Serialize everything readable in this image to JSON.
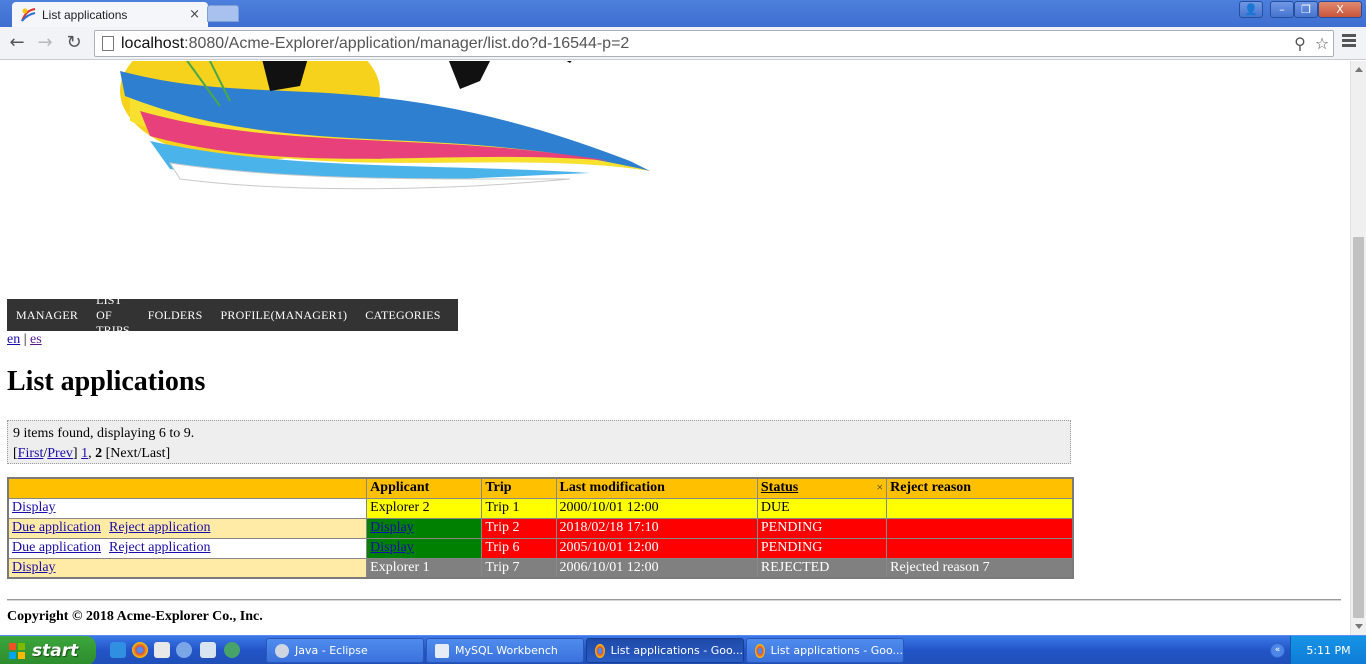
{
  "browser": {
    "tab_title": "List applications",
    "tab_close": "×",
    "url_host": "localhost",
    "url_rest": ":8080/Acme-Explorer/application/manager/list.do?d-16544-p=2",
    "window_buttons": {
      "user": "👤",
      "minimize": "–",
      "restore": "❐",
      "close": "X"
    }
  },
  "nav": {
    "back": "←",
    "forward": "→",
    "reload": "↻",
    "zoom_icon": "⚲",
    "star_icon": "☆"
  },
  "menu": {
    "items": [
      "MANAGER",
      "LIST OF TRIPS",
      "FOLDERS",
      "PROFILE(MANAGER1)",
      "CATEGORIES"
    ]
  },
  "languages": {
    "en": "en",
    "separator": " | ",
    "es": "es"
  },
  "page": {
    "title": "List applications",
    "found_text": "9 items found, displaying 6 to 9.",
    "pager": {
      "open": "[",
      "first": "First",
      "slash": "/",
      "prev": "Prev",
      "close": "] ",
      "page1": "1",
      "comma": ", ",
      "page2": "2",
      "tail": " [Next/Last]"
    }
  },
  "table": {
    "headers": {
      "actions": "",
      "applicant": "Applicant",
      "trip": "Trip",
      "last_modification": "Last modification",
      "status": "Status",
      "status_sort": "×",
      "reject_reason": "Reject reason"
    },
    "rows": [
      {
        "action1": "Display",
        "action2": "",
        "applicant": "Explorer 2",
        "trip": "Trip 1",
        "last_modification": "2000/10/01 12:00",
        "status": "DUE",
        "reject_reason": ""
      },
      {
        "action1": "Due application",
        "action2": "Reject application",
        "applicant": "Display",
        "trip": "Trip 2",
        "last_modification": "2018/02/18 17:10",
        "status": "PENDING",
        "reject_reason": ""
      },
      {
        "action1": "Due application",
        "action2": "Reject application",
        "applicant": "Display",
        "trip": "Trip 6",
        "last_modification": "2005/10/01 12:00",
        "status": "PENDING",
        "reject_reason": ""
      },
      {
        "action1": "Display",
        "action2": "",
        "applicant": "Explorer 1",
        "trip": "Trip 7",
        "last_modification": "2006/10/01 12:00",
        "status": "REJECTED",
        "reject_reason": "Rejected reason 7"
      }
    ],
    "colors": {
      "header": "#ffc000",
      "due": "#ffff00",
      "pending": "#ff0000",
      "pending_applicant": "#008000",
      "rejected": "#808080",
      "action_alt": "#ffeba6"
    }
  },
  "footer": {
    "copyright": "Copyright © 2018 Acme-Explorer Co., Inc."
  },
  "taskbar": {
    "start": "start",
    "tasks": [
      {
        "label": "Java - Eclipse",
        "icon": "gear-icon"
      },
      {
        "label": "MySQL Workbench",
        "icon": "mysql-icon"
      },
      {
        "label": "List applications - Goo...",
        "icon": "chrome-icon"
      },
      {
        "label": "List applications - Goo...",
        "icon": "chrome-icon"
      }
    ],
    "tray_arrow": "«",
    "clock": "5:11 PM"
  }
}
